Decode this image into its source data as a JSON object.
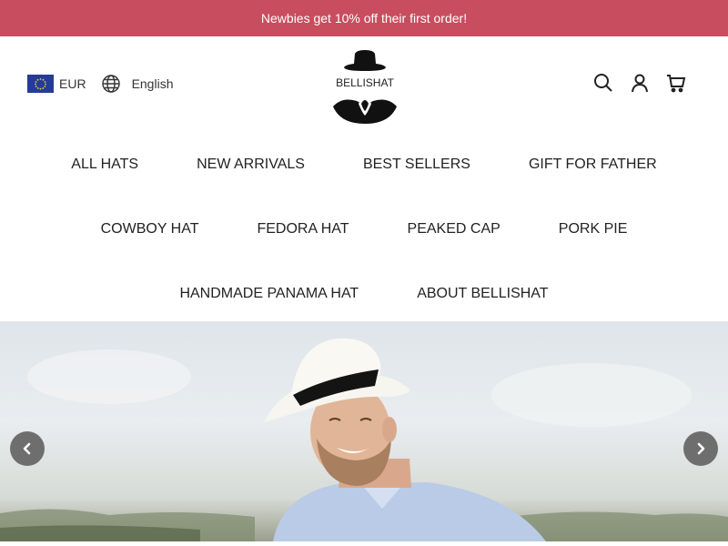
{
  "announcement": {
    "text": "Newbies get 10% off their first order!"
  },
  "header": {
    "currency": "EUR",
    "language": "English",
    "logo_text": "BELLISHAT",
    "icons": {
      "flag": "eu-flag-icon",
      "language": "globe-icon",
      "search": "search-icon",
      "account": "user-icon",
      "cart": "cart-icon"
    }
  },
  "nav": {
    "row1": [
      "ALL HATS",
      "NEW ARRIVALS",
      "BEST SELLERS",
      "GIFT FOR FATHER"
    ],
    "row2": [
      "COWBOY HAT",
      "FEDORA HAT",
      "PEAKED CAP",
      "PORK PIE"
    ],
    "row3": [
      "HANDMADE PANAMA HAT",
      "ABOUT BELLISHAT"
    ]
  },
  "hero": {
    "prev_icon": "chevron-left-icon",
    "next_icon": "chevron-right-icon"
  },
  "colors": {
    "announcement_bg": "#c84d5e",
    "text": "#222222",
    "arrow_bg": "#6e6e6e"
  }
}
